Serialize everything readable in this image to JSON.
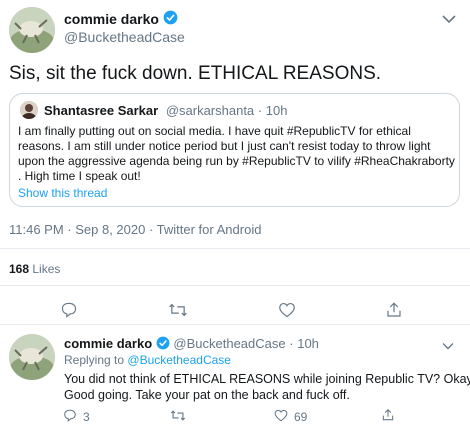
{
  "main_tweet": {
    "author_name": "commie darko",
    "author_handle": "@BucketheadCase",
    "text": "Sis, sit the fuck down. ETHICAL REASONS.",
    "quoted": {
      "author_name": "Shantasree Sarkar",
      "author_handle": "@sarkarshanta",
      "time_ago": "10h",
      "lines": [
        "I am finally putting out on social media. I have quit #RepublicTV for ethical",
        "reasons. I am still under notice period but I just can't resist today to throw light",
        "upon the aggressive agenda being run by #RepublicTV to vilify #RheaChakraborty",
        ". High time I speak out!"
      ],
      "show_thread": "Show this thread"
    },
    "timestamp": "11:46 PM · Sep 8, 2020 · Twitter for Android",
    "likes_count": "168",
    "likes_label": "Likes"
  },
  "reply": {
    "author_name": "commie darko",
    "author_handle": "@BucketheadCase",
    "time_ago": "10h",
    "replying_prefix": "Replying to",
    "replying_to": "@BucketheadCase",
    "lines": [
      "You did not think of ETHICAL REASONS while joining Republic TV? Okay.",
      "Good going. Take your pat on the back and fuck off."
    ],
    "reply_count": "3",
    "like_count": "69"
  },
  "colors": {
    "accent": "#1da1f2",
    "muted": "#657786",
    "border": "#e6ecf0"
  }
}
